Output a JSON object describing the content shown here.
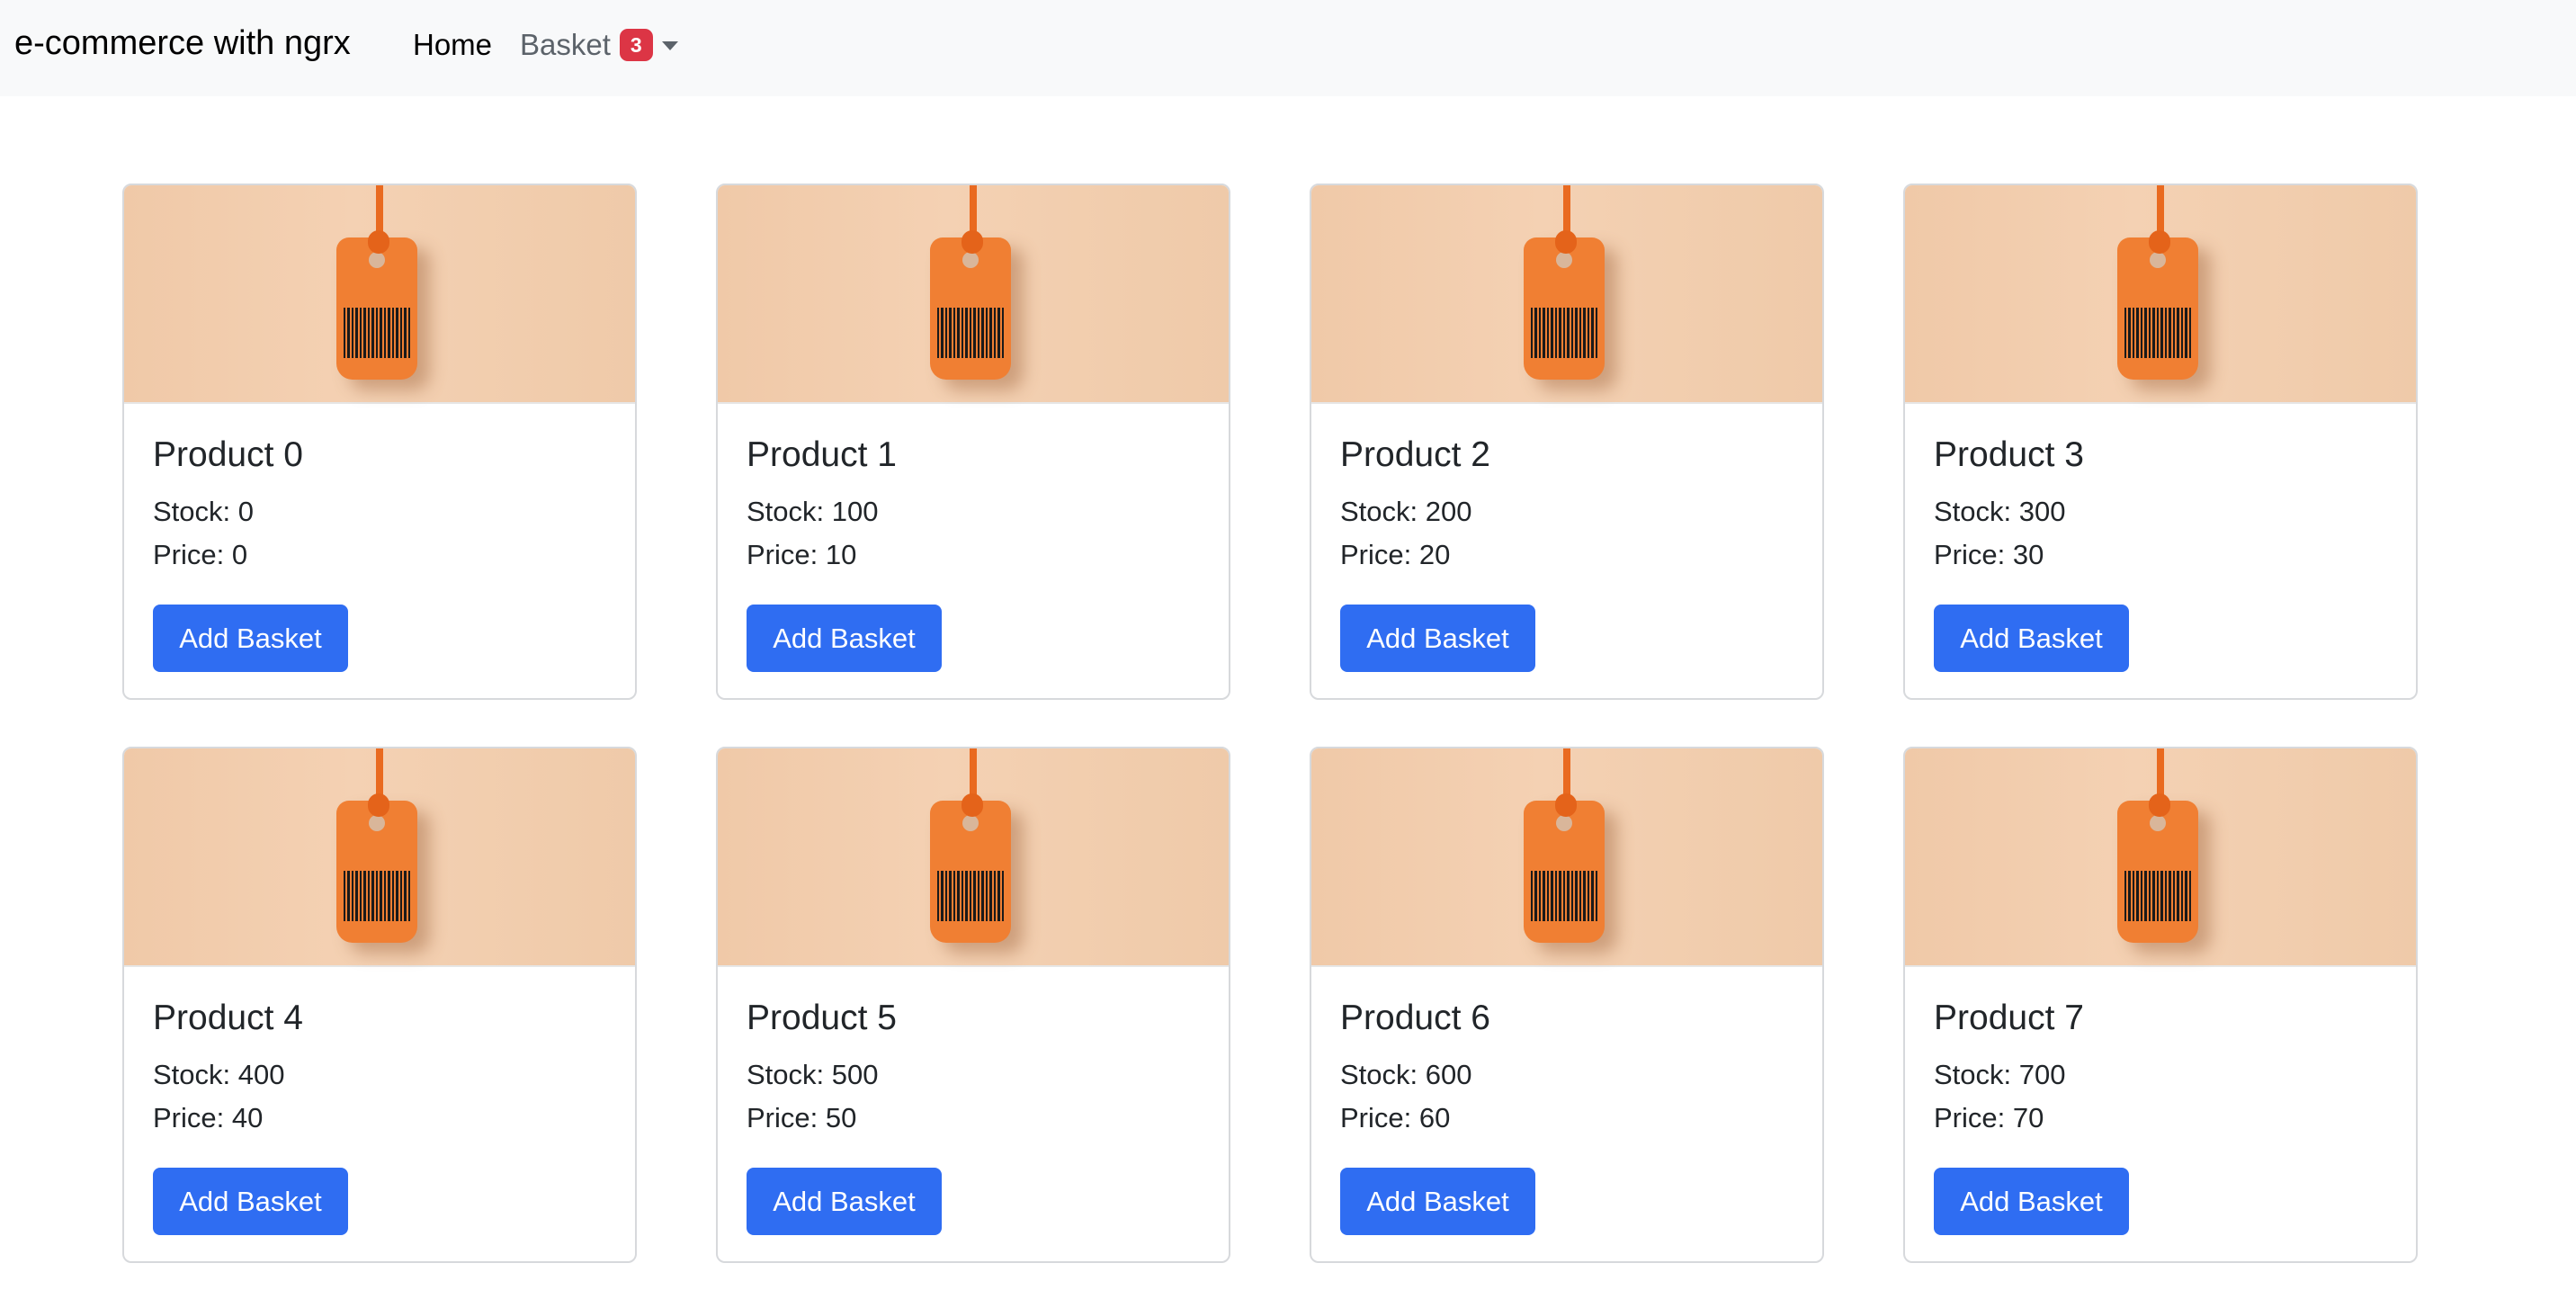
{
  "navbar": {
    "brand": "e-commerce with ngrx",
    "home_label": "Home",
    "basket_label": "Basket",
    "basket_count": "3"
  },
  "colors": {
    "primary": "#2f6df2",
    "badge": "#dc3545",
    "navbar_bg": "#f8f9fa"
  },
  "products": [
    {
      "title": "Product 0",
      "stock": "Stock: 0",
      "price": "Price: 0",
      "button": "Add Basket",
      "image": "price-tag-image"
    },
    {
      "title": "Product 1",
      "stock": "Stock: 100",
      "price": "Price: 10",
      "button": "Add Basket",
      "image": "price-tag-image"
    },
    {
      "title": "Product 2",
      "stock": "Stock: 200",
      "price": "Price: 20",
      "button": "Add Basket",
      "image": "price-tag-image"
    },
    {
      "title": "Product 3",
      "stock": "Stock: 300",
      "price": "Price: 30",
      "button": "Add Basket",
      "image": "price-tag-image"
    },
    {
      "title": "Product 4",
      "stock": "Stock: 400",
      "price": "Price: 40",
      "button": "Add Basket",
      "image": "price-tag-image"
    },
    {
      "title": "Product 5",
      "stock": "Stock: 500",
      "price": "Price: 50",
      "button": "Add Basket",
      "image": "price-tag-image"
    },
    {
      "title": "Product 6",
      "stock": "Stock: 600",
      "price": "Price: 60",
      "button": "Add Basket",
      "image": "price-tag-image"
    },
    {
      "title": "Product 7",
      "stock": "Stock: 700",
      "price": "Price: 70",
      "button": "Add Basket",
      "image": "price-tag-image"
    }
  ]
}
